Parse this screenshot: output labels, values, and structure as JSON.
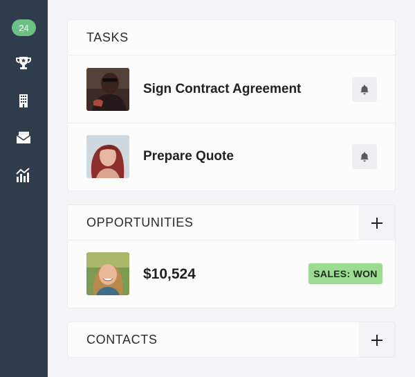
{
  "sidebar": {
    "badge_count": "24",
    "icons": [
      "trophy-icon",
      "building-icon",
      "mail-icon",
      "chart-icon"
    ],
    "accent": "#6cc083",
    "background": "#2f3c4b"
  },
  "tasks": {
    "title": "TASKS",
    "items": [
      {
        "label": "Sign Contract Agreement",
        "avatar": "avatar-man",
        "action_icon": "bell-icon"
      },
      {
        "label": "Prepare Quote",
        "avatar": "avatar-woman-redhair",
        "action_icon": "bell-icon"
      }
    ]
  },
  "opportunities": {
    "title": "OPPORTUNITIES",
    "add_icon": "plus-icon",
    "items": [
      {
        "amount": "$10,524",
        "status": "SALES: WON",
        "status_color": "#9bdc92",
        "avatar": "avatar-woman-smiling"
      }
    ]
  },
  "contacts": {
    "title": "CONTACTS",
    "add_icon": "plus-icon"
  }
}
